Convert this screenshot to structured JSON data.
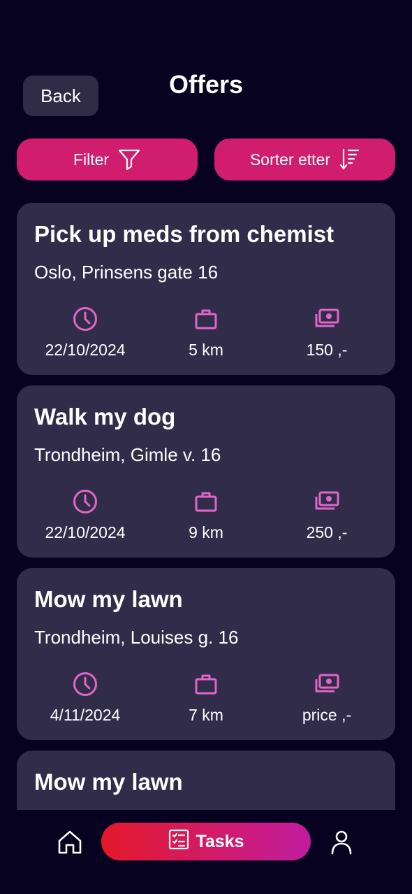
{
  "header": {
    "back_label": "Back",
    "title": "Offers"
  },
  "toolbar": {
    "filter_label": "Filter",
    "sort_label": "Sorter etter"
  },
  "colors": {
    "background": "#06021f",
    "card": "#322c4b",
    "accent": "#d01d6d",
    "icon": "#e066c8"
  },
  "offers": [
    {
      "title": "Pick up meds from chemist",
      "address": "Oslo, Prinsens gate 16",
      "date": "22/10/2024",
      "distance": "5 km",
      "price": "150 ,-"
    },
    {
      "title": "Walk my dog",
      "address": "Trondheim, Gimle v. 16",
      "date": "22/10/2024",
      "distance": "9 km",
      "price": "250 ,-"
    },
    {
      "title": "Mow my lawn",
      "address": "Trondheim, Louises g. 16",
      "date": "4/11/2024",
      "distance": "7 km",
      "price": "price ,-"
    },
    {
      "title": "Mow my lawn"
    }
  ],
  "icons": {
    "date": "clock-icon",
    "distance": "briefcase-icon",
    "price": "money-icon"
  },
  "nav": {
    "tasks_label": "Tasks",
    "home_icon": "home-icon",
    "profile_icon": "profile-icon"
  }
}
